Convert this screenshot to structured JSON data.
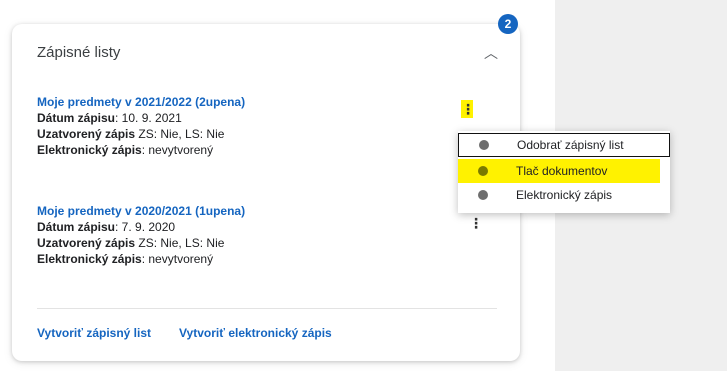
{
  "badge": {
    "count": "2"
  },
  "card": {
    "title": "Zápisné listy",
    "entries": [
      {
        "title": "Moje predmety v 2021/2022 (2upena)",
        "date_label": "Dátum zápisu",
        "date_value": ": 10. 9. 2021",
        "closed_label": "Uzatvorený zápis",
        "closed_value": " ZS: Nie,  LS: Nie",
        "electronic_label": "Elektronický zápis",
        "electronic_value": ": nevytvorený"
      },
      {
        "title": "Moje predmety v 2020/2021 (1upena)",
        "date_label": "Dátum zápisu",
        "date_value": ": 7. 9. 2020",
        "closed_label": "Uzatvorený zápis",
        "closed_value": " ZS: Nie,  LS: Nie",
        "electronic_label": "Elektronický zápis",
        "electronic_value": ": nevytvorený"
      }
    ],
    "footer": {
      "create_list": "Vytvoriť zápisný list",
      "create_electronic": "Vytvoriť elektronický zápis"
    }
  },
  "menu": {
    "items": [
      {
        "label": "Odobrať zápisný list"
      },
      {
        "label": "Tlač dokumentov"
      },
      {
        "label": "Elektronický zápis"
      }
    ]
  },
  "icons": {
    "collapse": "chevron-up-icon",
    "more": "kebab-menu-icon",
    "bullet": "dot-icon"
  },
  "colors": {
    "accent": "#1565c0",
    "highlight": "#fff200",
    "side_panel": "#efefef"
  }
}
